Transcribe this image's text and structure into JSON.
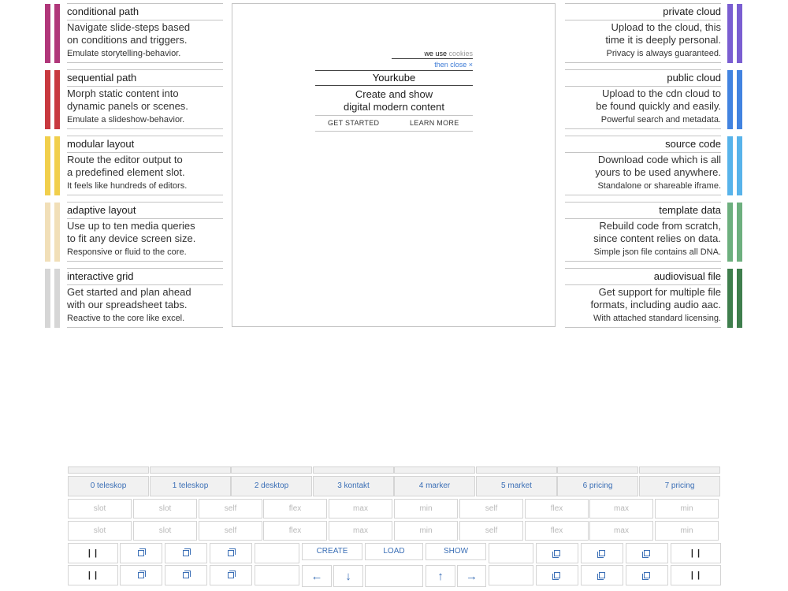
{
  "cards_left": [
    {
      "title": "conditional path",
      "desc1": "Navigate slide-steps based",
      "desc2": "on conditions and triggers.",
      "note": "Emulate storytelling-behavior.",
      "color": "#b0377a"
    },
    {
      "title": "sequential path",
      "desc1": "Morph static content into",
      "desc2": "dynamic panels or scenes.",
      "note": "Emulate a slideshow-behavior.",
      "color": "#c8393f"
    },
    {
      "title": "modular layout",
      "desc1": "Route the editor output to",
      "desc2": "a predefined element slot.",
      "note": "It feels like hundreds of editors.",
      "color": "#f1cf4c"
    },
    {
      "title": "adaptive layout",
      "desc1": "Use up to ten media queries",
      "desc2": "to fit any device screen size.",
      "note": "Responsive or fluid to the core.",
      "color": "#f1dfb8"
    },
    {
      "title": "interactive grid",
      "desc1": "Get started and plan ahead",
      "desc2": "with our spreadsheet tabs.",
      "note": "Reactive to the core like excel.",
      "color": "#d6d6d6"
    }
  ],
  "cards_right": [
    {
      "title": "private cloud",
      "desc1": "Upload to the cloud, this",
      "desc2": "time it is deeply personal.",
      "note": "Privacy is always guaranteed.",
      "color": "#7a5ed1"
    },
    {
      "title": "public cloud",
      "desc1": "Upload to the cdn cloud to",
      "desc2": "be found quickly and easily.",
      "note": "Powerful search and metadata.",
      "color": "#4283e0"
    },
    {
      "title": "source code",
      "desc1": "Download code which is all",
      "desc2": "yours to be used anywhere.",
      "note": "Standalone or shareable iframe.",
      "color": "#58b3ea"
    },
    {
      "title": "template data",
      "desc1": "Rebuild code from scratch,",
      "desc2": "since content relies on data.",
      "note": "Simple json file contains all DNA.",
      "color": "#6daf7e"
    },
    {
      "title": "audiovisual file",
      "desc1": "Get support for multiple file",
      "desc2": "formats, including audio aac.",
      "note": "With attached standard licensing.",
      "color": "#3f7e4d"
    }
  ],
  "stage": {
    "cookie_prefix": "we use",
    "cookie_link": "cookies",
    "cookie_close": "then close ×",
    "title": "Yourkube",
    "subtitle1": "Create and show",
    "subtitle2": "digital modern content",
    "get_started": "GET STARTED",
    "learn_more": "LEARN MORE"
  },
  "grid": {
    "tabs": [
      "0 teleskop",
      "1 teleskop",
      "2 desktop",
      "3 kontakt",
      "4 marker",
      "5 market",
      "6 pricing",
      "7 pricing"
    ],
    "row1": [
      "slot",
      "slot",
      "self",
      "flex",
      "max",
      "min",
      "self",
      "flex",
      "max",
      "min"
    ],
    "row2": [
      "slot",
      "slot",
      "self",
      "flex",
      "max",
      "min",
      "self",
      "flex",
      "max",
      "min"
    ],
    "create": "CREATE",
    "load": "LOAD",
    "show": "SHOW",
    "pause": "| |"
  }
}
